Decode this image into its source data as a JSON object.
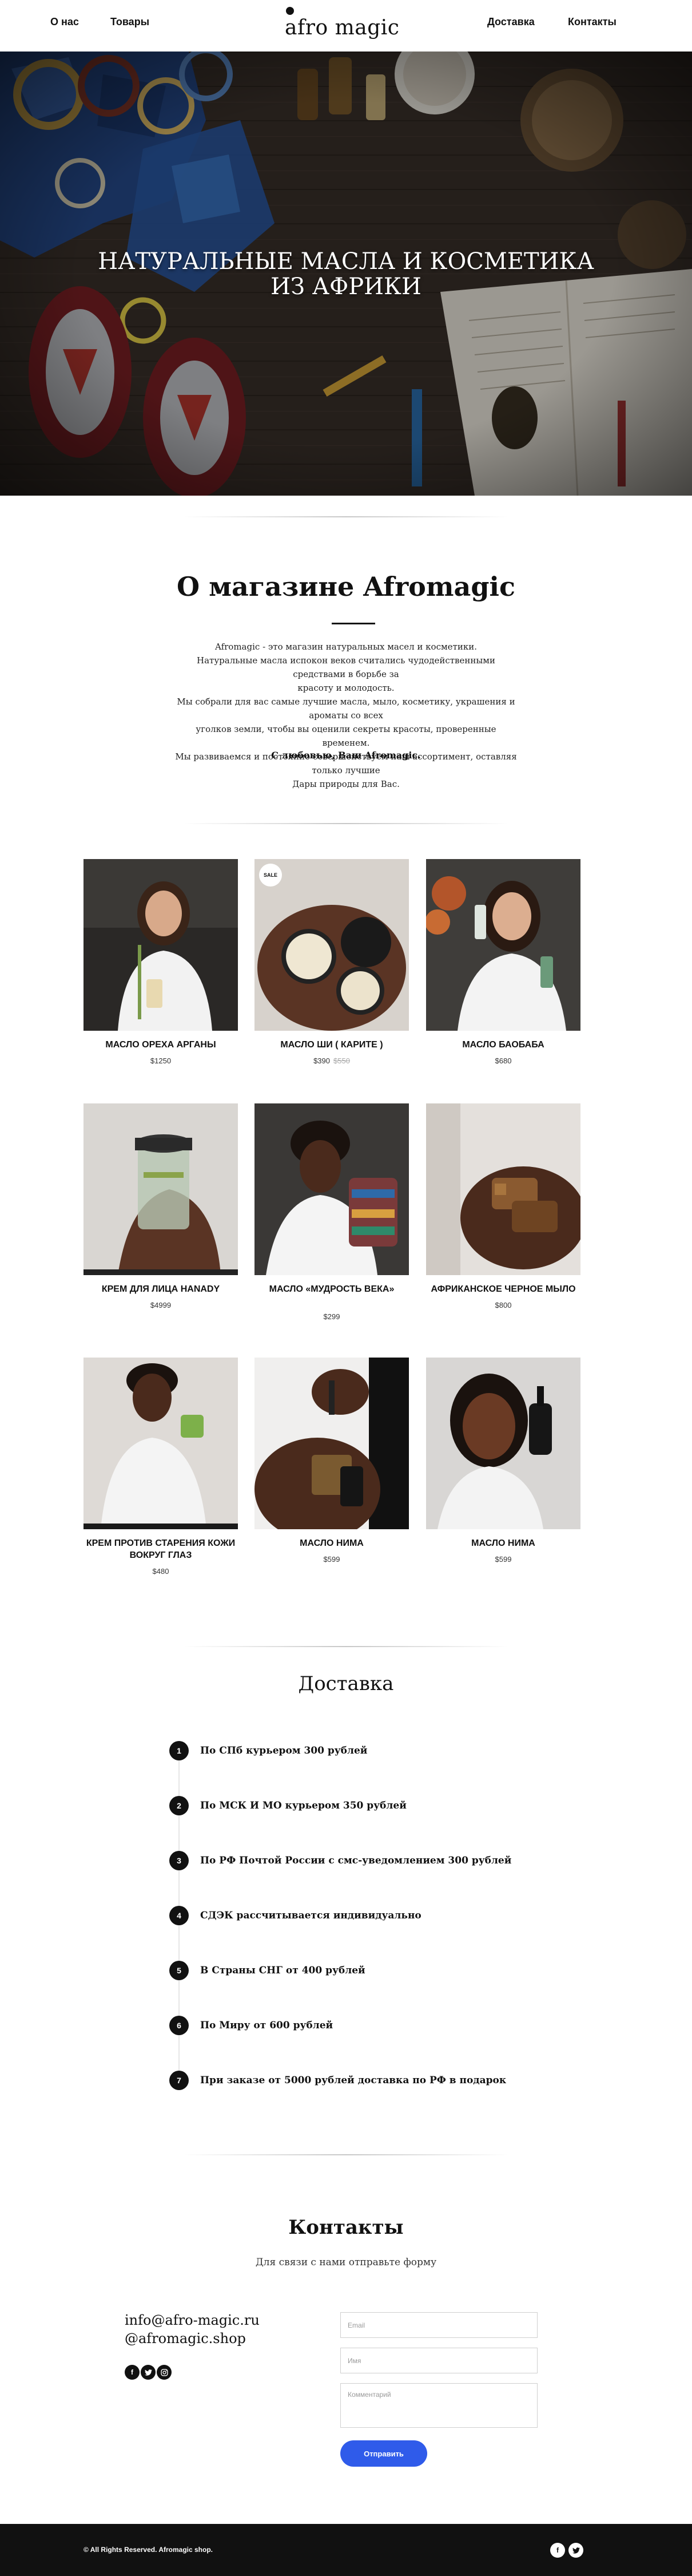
{
  "header": {
    "nav_left": [
      "О нас",
      "Товары"
    ],
    "logo_text": "afro magic",
    "nav_right": [
      "Доставка",
      "Контакты"
    ]
  },
  "hero": {
    "title_line1": "НАТУРАЛЬНЫЕ МАСЛА И КОСМЕТИКА",
    "title_line2": "ИЗ АФРИКИ"
  },
  "about": {
    "title": "О магазине Afromagic",
    "lines": [
      "Afromagic - это магазин натуральных масел и косметики.",
      "Натуральные масла испокон веков считались чудодейственными средствами в борьбе за",
      "красоту и молодость.",
      "Мы собрали для вас самые лучшие масла, мыло, косметику, украшения и ароматы со всех",
      "уголков земли, чтобы вы оценили секреты красоты, проверенные временем.",
      "Мы развиваемся и постоянно совершенствуем наш ассортимент, оставляя только лучшие",
      "Дары природы для Вас."
    ],
    "signature": "С любовью, Ваш Afromagic."
  },
  "products": [
    {
      "name": "МАСЛО ОРЕХА АРГАНЫ",
      "price": "$1250",
      "old_price": "",
      "badge": ""
    },
    {
      "name": "МАСЛО ШИ ( КАРИТЕ )",
      "price": "$390",
      "old_price": "$550",
      "badge": "SALE"
    },
    {
      "name": "МАСЛО БАОБАБА",
      "price": "$680",
      "old_price": "",
      "badge": ""
    },
    {
      "name": "КРЕМ ДЛЯ ЛИЦА HANADY",
      "price": "$4999",
      "old_price": "",
      "badge": ""
    },
    {
      "name": "МАСЛО «МУДРОСТЬ ВЕКА»",
      "price": "$299",
      "old_price": "",
      "badge": ""
    },
    {
      "name": "АФРИКАНСКОЕ ЧЕРНОЕ МЫЛО",
      "price": "$800",
      "old_price": "",
      "badge": ""
    },
    {
      "name": "КРЕМ ПРОТИВ СТАРЕНИЯ КОЖИ ВОКРУГ ГЛАЗ",
      "price": "$480",
      "old_price": "",
      "badge": ""
    },
    {
      "name": "МАСЛО НИМА",
      "price": "$599",
      "old_price": "",
      "badge": ""
    },
    {
      "name": "МАСЛО НИМА",
      "price": "$599",
      "old_price": "",
      "badge": ""
    }
  ],
  "delivery": {
    "title": "Доставка",
    "steps": [
      {
        "num": "1",
        "text": "По СПб курьером 300 рублей"
      },
      {
        "num": "2",
        "text": "По МСК И МО курьером 350 рублей"
      },
      {
        "num": "3",
        "text": "По РФ Почтой России с смс-уведомлением 300 рублей"
      },
      {
        "num": "4",
        "text": "СДЭК рассчитывается индивидуально"
      },
      {
        "num": "5",
        "text": "В Страны СНГ от 400 рублей"
      },
      {
        "num": "6",
        "text": "По Миру от 600 рублей"
      },
      {
        "num": "7",
        "text": "При заказе от 5000 рублей доставка по РФ в подарок"
      }
    ]
  },
  "contacts": {
    "title": "Контакты",
    "subtitle": "Для связи с нами отправьте форму",
    "email": "info@afro-magic.ru",
    "instagram": "@afromagic.shop",
    "social_icons": [
      "facebook-icon",
      "twitter-icon",
      "instagram-icon"
    ],
    "form": {
      "email_placeholder": "Email",
      "name_placeholder": "Имя",
      "comment_placeholder": "Комментарий",
      "submit_label": "Отправить"
    }
  },
  "footer": {
    "copyright": "© All Rights Reserved. Afromagic shop.",
    "social_icons": [
      "facebook-icon",
      "twitter-icon"
    ]
  },
  "colors": {
    "accent": "#2f5bea",
    "footer_bg": "#111111",
    "text": "#111111"
  }
}
